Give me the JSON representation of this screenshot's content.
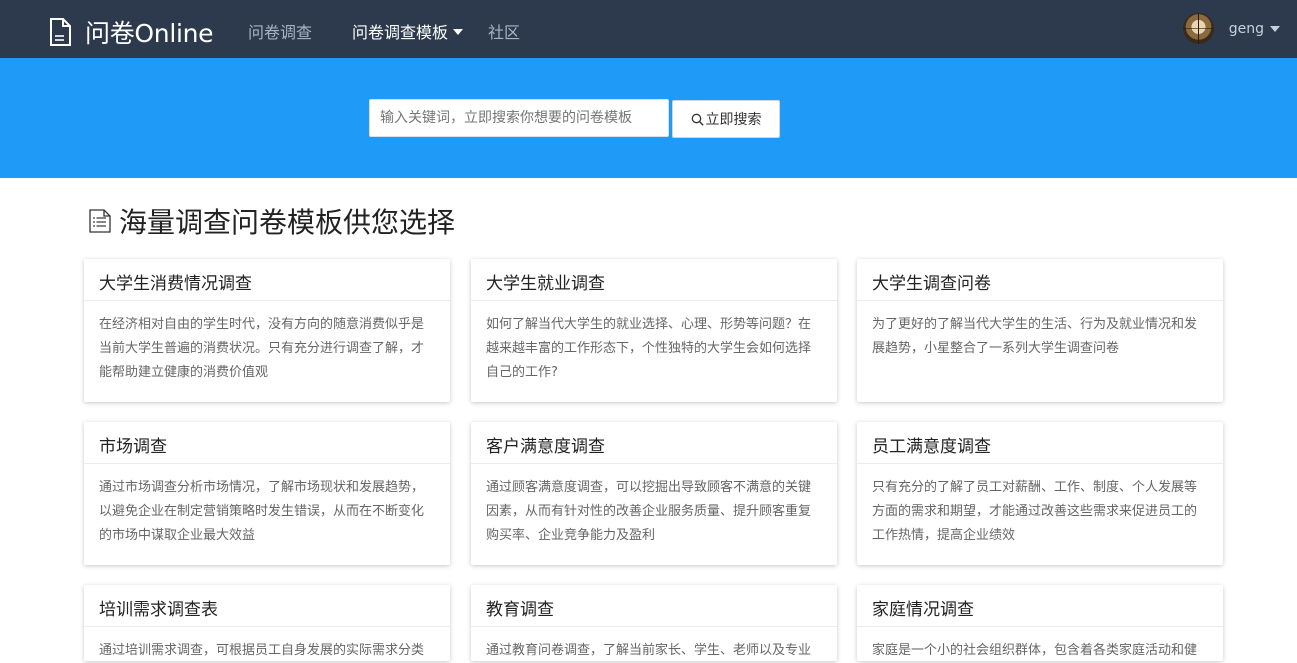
{
  "navbar": {
    "brand": "问卷Online",
    "items": [
      {
        "label": "问卷调查"
      },
      {
        "label": "问卷调查模板"
      },
      {
        "label": "社区"
      }
    ],
    "username": "geng"
  },
  "search": {
    "placeholder": "输入关键词，立即搜索你想要的问卷模板",
    "button_label": "立即搜索"
  },
  "section": {
    "title": "海量调查问卷模板供您选择"
  },
  "colors": {
    "navbar_bg": "#2d3a4d",
    "hero_bg": "#1f9bf7"
  },
  "cards": [
    {
      "title": "大学生消费情况调查",
      "desc": "在经济相对自由的学生时代，没有方向的随意消费似乎是当前大学生普遍的消费状况。只有充分进行调查了解，才能帮助建立健康的消费价值观"
    },
    {
      "title": "大学生就业调查",
      "desc": "如何了解当代大学生的就业选择、心理、形势等问题？在越来越丰富的工作形态下，个性独特的大学生会如何选择自己的工作?"
    },
    {
      "title": "大学生调查问卷",
      "desc": "为了更好的了解当代大学生的生活、行为及就业情况和发展趋势，小星整合了一系列大学生调查问卷"
    },
    {
      "title": "市场调查",
      "desc": "通过市场调查分析市场情况，了解市场现状和发展趋势，以避免企业在制定营销策略时发生错误，从而在不断变化的市场中谋取企业最大效益"
    },
    {
      "title": "客户满意度调查",
      "desc": "通过顾客满意度调查，可以挖掘出导致顾客不满意的关键因素，从而有针对性的改善企业服务质量、提升顾客重复购买率、企业竞争能力及盈利"
    },
    {
      "title": "员工满意度调查",
      "desc": "只有充分的了解了员工对薪酬、工作、制度、个人发展等方面的需求和期望，才能通过改善这些需求来促进员工的工作热情，提高企业绩效"
    },
    {
      "title": "培训需求调查表",
      "desc": "通过培训需求调查，可根据员工自身发展的实际需求分类"
    },
    {
      "title": "教育调查",
      "desc": "通过教育问卷调查，了解当前家长、学生、老师以及专业"
    },
    {
      "title": "家庭情况调查",
      "desc": "家庭是一个小的社会组织群体，包含着各类家庭活动和健"
    }
  ]
}
